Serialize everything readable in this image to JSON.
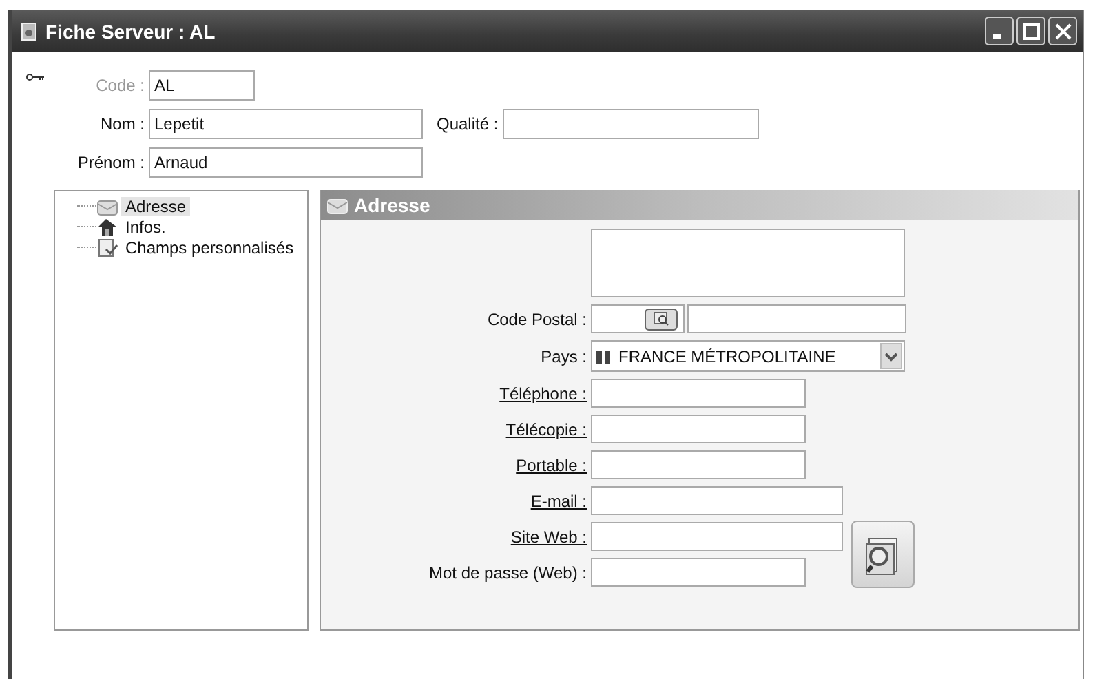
{
  "window": {
    "title": "Fiche Serveur : AL"
  },
  "header_fields": [
    {
      "label": "Code :",
      "value": "AL",
      "disabled": true
    },
    {
      "label": "Nom :",
      "value": "Lepetit",
      "disabled": false
    },
    {
      "label": "Qualité :",
      "disabled": false
    },
    {
      "label": "Prénom :",
      "value": "Arnaud",
      "disabled": false
    }
  ],
  "tree": {
    "items": [
      {
        "label": "Adresse",
        "selected": true
      },
      {
        "label": "Infos.",
        "selected": false
      },
      {
        "label": "Champs personnalisés",
        "selected": false
      }
    ]
  },
  "panel": {
    "title": "Adresse",
    "fields": [
      {
        "kind": "memo"
      },
      {
        "kind": "postal",
        "label": "Code Postal :"
      },
      {
        "kind": "select",
        "label": "Pays :",
        "value": "FRANCE MÉTROPOLITAINE"
      },
      {
        "kind": "link",
        "label": "Téléphone :"
      },
      {
        "kind": "link",
        "label": "Télécopie :"
      },
      {
        "kind": "link",
        "label": "Portable :"
      },
      {
        "kind": "link-wide",
        "label": "E-mail :"
      },
      {
        "kind": "link-wide",
        "label": "Site Web :"
      },
      {
        "kind": "text",
        "label": "Mot de passe (Web) :"
      }
    ]
  }
}
